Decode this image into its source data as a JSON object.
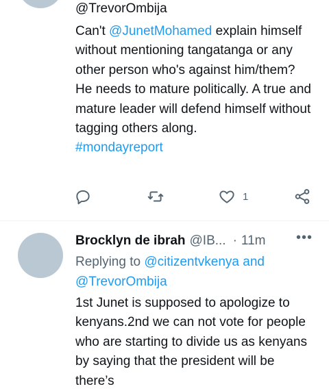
{
  "tweet1": {
    "replying_handle": "@TrevorOmbija",
    "text_pre": "Can't ",
    "mention": "@JunetMohamed",
    "text_post": "  explain himself without mentioning tangatanga or any other person who's against him/them? He needs to mature politically.  A true and mature leader will defend himself without tagging others along.",
    "hashtag": "#mondayreport",
    "actions": {
      "reply_icon": "reply-icon",
      "retweet_icon": "retweet-icon",
      "like_icon": "heart-icon",
      "like_count": "1",
      "share_icon": "share-icon"
    }
  },
  "tweet2": {
    "author_name": "Brocklyn de ibrah",
    "author_handle": "@IB...",
    "separator": "·",
    "time": "11m",
    "more": "•••",
    "replying_to_label": "Replying to ",
    "replying_to_1": "@citizentvkenya",
    "replying_and": " and",
    "replying_to_2": "@TrevorOmbija",
    "text": "1st Junet is supposed to apologize to kenyans.2nd we can not vote for people who are starting to divide us as kenyans by saying that the president will be there’s"
  },
  "colors": {
    "link": "#1d9bf0",
    "muted": "#536471",
    "text": "#0f1419",
    "avatar": "#b9c8d2"
  }
}
